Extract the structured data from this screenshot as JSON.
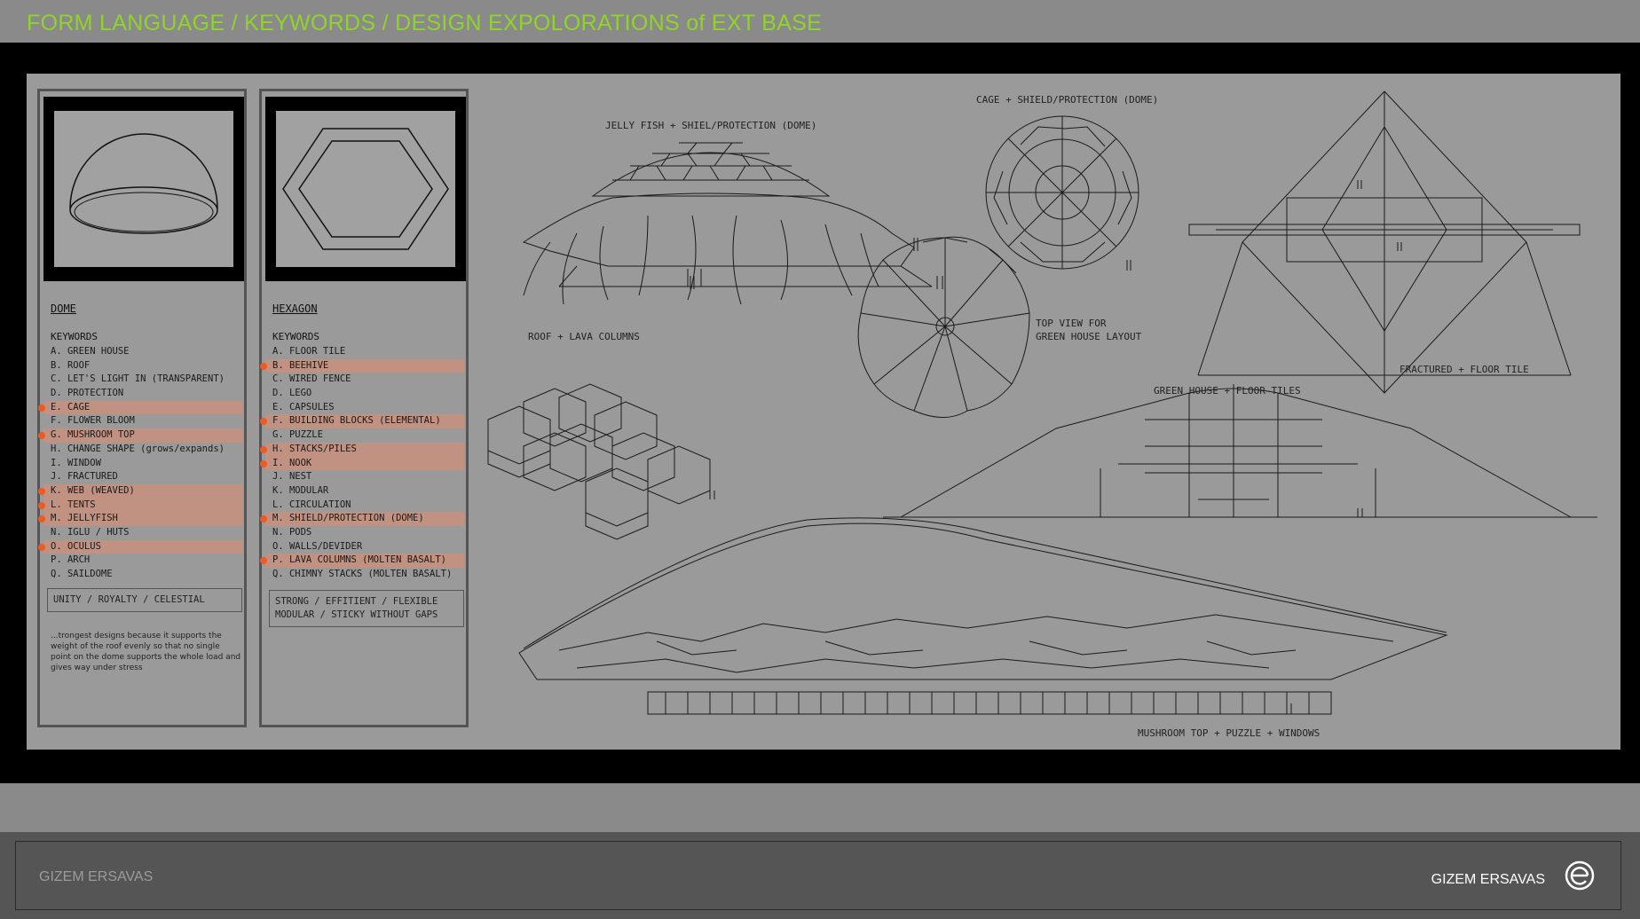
{
  "header": {
    "title": "FORM LANGUAGE / KEYWORDS / DESIGN EXPOLORATIONS of EXT BASE"
  },
  "dome_panel": {
    "heading": "DOME",
    "keywords_title": "KEYWORDS",
    "keywords": [
      {
        "text": "A. GREEN HOUSE",
        "highlighted": false
      },
      {
        "text": "B. ROOF",
        "highlighted": false
      },
      {
        "text": "C. LET'S LIGHT IN (TRANSPARENT)",
        "highlighted": false
      },
      {
        "text": "D. PROTECTION",
        "highlighted": false
      },
      {
        "text": "E. CAGE",
        "highlighted": true
      },
      {
        "text": "F. FLOWER BLOOM",
        "highlighted": false
      },
      {
        "text": "G. MUSHROOM TOP",
        "highlighted": true
      },
      {
        "text": "H. CHANGE SHAPE (grows/expands)",
        "highlighted": false
      },
      {
        "text": "I. WINDOW",
        "highlighted": false
      },
      {
        "text": "J. FRACTURED",
        "highlighted": false
      },
      {
        "text": "K. WEB (WEAVED)",
        "highlighted": true
      },
      {
        "text": "L. TENTS",
        "highlighted": true
      },
      {
        "text": "M. JELLYFISH",
        "highlighted": true
      },
      {
        "text": "N. IGLU / HUTS",
        "highlighted": false
      },
      {
        "text": "O. OCULUS",
        "highlighted": true
      },
      {
        "text": "P. ARCH",
        "highlighted": false
      },
      {
        "text": "Q. SAILDOME",
        "highlighted": false
      }
    ],
    "summary_line1": "UNITY / ROYALTY / CELESTIAL",
    "note": "...trongest designs because it supports the weight of the roof evenly so that no single point on the dome supports the whole load and gives way under stress"
  },
  "hexagon_panel": {
    "heading": "HEXAGON",
    "keywords_title": "KEYWORDS",
    "keywords": [
      {
        "text": "A. FLOOR TILE",
        "highlighted": false
      },
      {
        "text": "B. BEEHIVE",
        "highlighted": true
      },
      {
        "text": "C. WIRED FENCE",
        "highlighted": false
      },
      {
        "text": "D. LEGO",
        "highlighted": false
      },
      {
        "text": "E. CAPSULES",
        "highlighted": false
      },
      {
        "text": "F. BUILDING BLOCKS (ELEMENTAL)",
        "highlighted": true
      },
      {
        "text": "G. PUZZLE",
        "highlighted": false
      },
      {
        "text": "H. STACKS/PILES",
        "highlighted": true
      },
      {
        "text": "I. NOOK",
        "highlighted": true
      },
      {
        "text": "J. NEST",
        "highlighted": false
      },
      {
        "text": "K. MODULAR",
        "highlighted": false
      },
      {
        "text": "L. CIRCULATION",
        "highlighted": false
      },
      {
        "text": "M. SHIELD/PROTECTION (DOME)",
        "highlighted": true
      },
      {
        "text": "N. PODS",
        "highlighted": false
      },
      {
        "text": "O. WALLS/DEVIDER",
        "highlighted": false
      },
      {
        "text": "P. LAVA COLUMNS (MOLTEN BASALT)",
        "highlighted": true
      },
      {
        "text": "Q. CHIMNY STACKS (MOLTEN BASALT)",
        "highlighted": false
      }
    ],
    "summary_line1": "STRONG / EFFITIENT / FLEXIBLE",
    "summary_line2": "MODULAR / STICKY WITHOUT GAPS"
  },
  "sketch_labels": {
    "jellyfish": "JELLY FISH + SHIEL/PROTECTION (DOME)",
    "cage": "CAGE + SHIELD/PROTECTION (DOME)",
    "roof_lava": "ROOF + LAVA COLUMNS",
    "top_view_line1": "TOP VIEW FOR",
    "top_view_line2": "GREEN HOUSE LAYOUT",
    "fractured": "FRACTURED + FLOOR TILE",
    "greenhouse": "GREEN HOUSE + FLOOR TILES",
    "mushroom": "MUSHROOM TOP + PUZZLE + WINDOWS"
  },
  "footer": {
    "left": "GIZEM ERSAVAS",
    "right": "GIZEM ERSAVAS"
  },
  "colors": {
    "title_green": "#8fd42a",
    "highlight_dot": "#ef5a22",
    "highlight_bar": "#e08c6e"
  }
}
